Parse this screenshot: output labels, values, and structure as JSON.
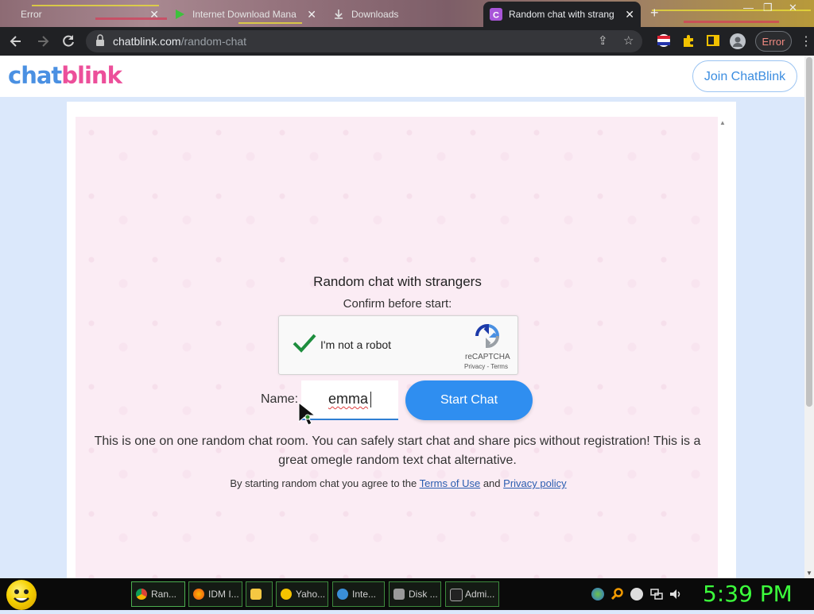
{
  "browser": {
    "tabs": [
      {
        "label": "Error",
        "active": false
      },
      {
        "label": "Internet Download Mana",
        "active": false
      },
      {
        "label": "Downloads",
        "active": false
      },
      {
        "label": "Random chat with strang",
        "active": true
      }
    ],
    "url_domain": "chatblink.com",
    "url_path": "/random-chat",
    "error_label": "Error"
  },
  "site": {
    "logo_chat": "chat",
    "logo_blink": "blink",
    "join_label": "Join ChatBlink"
  },
  "main": {
    "heading": "Random chat with strangers",
    "confirm": "Confirm before start:",
    "recaptcha": {
      "label": "I'm not a robot",
      "brand": "reCAPTCHA",
      "terms": "Privacy - Terms"
    },
    "name_label": "Name:",
    "name_value": "emma",
    "start_label": "Start Chat",
    "description": "This is one on one random chat room. You can safely start chat and share pics without registration! This is a great omegle random text chat alternative.",
    "terms_prefix": "By starting random chat you agree to the",
    "terms_link": "Terms of Use",
    "terms_and": "and",
    "privacy_link": "Privacy policy"
  },
  "taskbar": {
    "items": [
      "Ran...",
      "IDM I...",
      "",
      "Yaho...",
      "Inte...",
      "Disk ...",
      "Admi..."
    ],
    "clock": "5:39 PM"
  },
  "colors": {
    "logo_chat": "#4a90e2",
    "logo_blink": "#ec4f9a",
    "start_button": "#2f8ef0",
    "link": "#2a5db0",
    "clock": "#3cff3c"
  }
}
